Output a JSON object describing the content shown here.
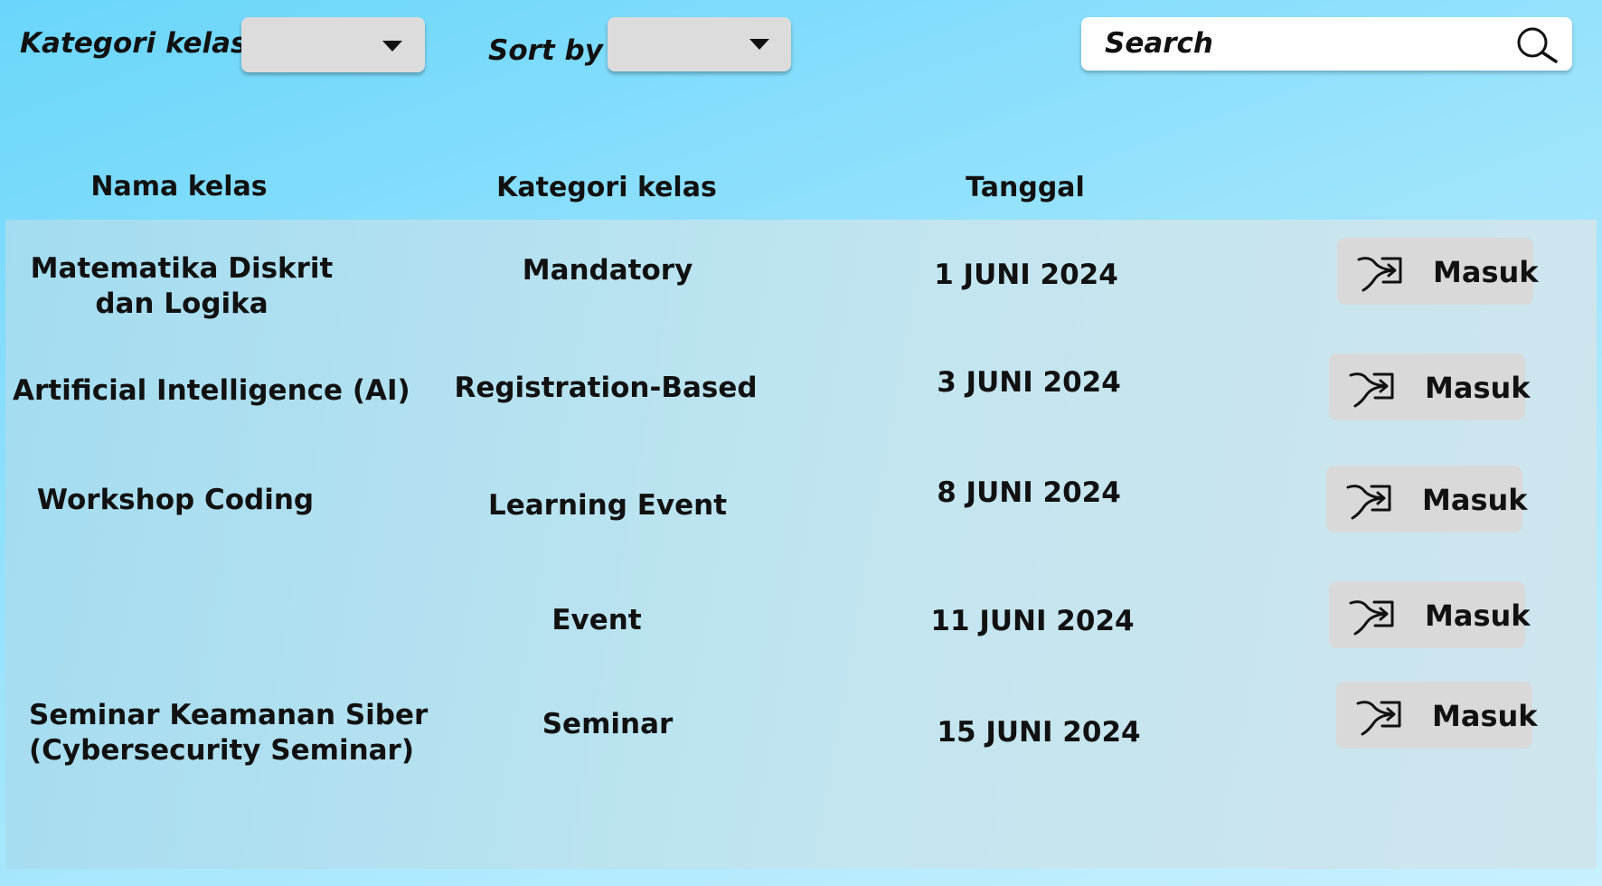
{
  "filters": {
    "category_label": "Kategori kelas",
    "category_value": "",
    "sort_label": "Sort by",
    "sort_value": ""
  },
  "search": {
    "placeholder": "Search"
  },
  "table": {
    "headers": [
      "Nama kelas",
      "Kategori kelas",
      "Tanggal"
    ],
    "action_label": "Masuk",
    "rows": [
      {
        "name_lines": [
          "Matematika Diskrit",
          "dan Logika"
        ],
        "category": "Mandatory",
        "date": "1 JUNI 2024"
      },
      {
        "name_lines": [
          "Artificial Intelligence (AI)"
        ],
        "category": "Registration-Based",
        "date": "3 JUNI 2024"
      },
      {
        "name_lines": [
          "Workshop Coding"
        ],
        "category": "Learning Event",
        "date": "8 JUNI 2024"
      },
      {
        "name_lines": [],
        "category": "Event",
        "date": "11 JUNI 2024"
      },
      {
        "name_lines": [
          "Seminar Keamanan Siber",
          "(Cybersecurity Seminar)"
        ],
        "category": "Seminar",
        "date": "15 JUNI 2024"
      }
    ]
  },
  "icons": {
    "dropdown": "caret-down-icon",
    "search": "magnifier-icon",
    "enter": "enter-arrow-icon"
  },
  "colors": {
    "background_start": "#6ad6fb",
    "background_end": "#c8f0ff",
    "panel": "#b6e0ef",
    "button": "#d9d9d9",
    "dropdown": "#dcdcdc",
    "search_bg": "#ffffff",
    "text": "#111111"
  }
}
